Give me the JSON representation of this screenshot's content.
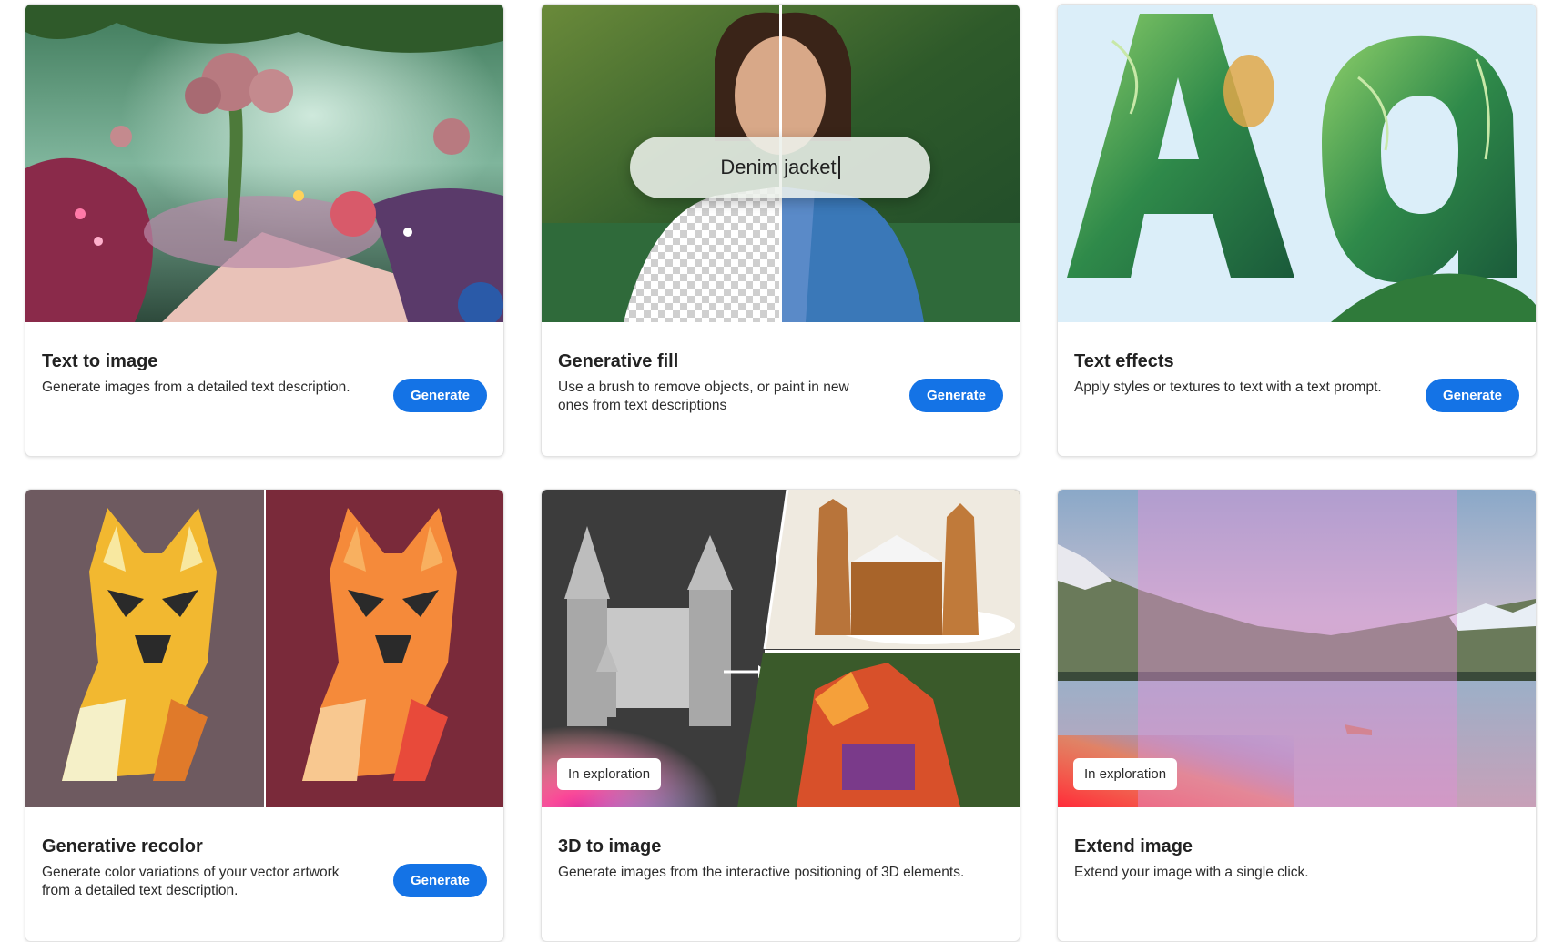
{
  "cards": [
    {
      "title": "Text to image",
      "description": "Generate images from a detailed text description.",
      "button": "Generate"
    },
    {
      "title": "Generative fill",
      "description": "Use a brush to remove objects, or paint in new ones from text descriptions",
      "button": "Generate",
      "prompt_text": "Denim jacket"
    },
    {
      "title": "Text effects",
      "description": "Apply styles or textures to text with a text prompt.",
      "button": "Generate"
    },
    {
      "title": "Generative recolor",
      "description": "Generate color variations of your vector artwork from a detailed text description.",
      "button": "Generate"
    },
    {
      "title": "3D to image",
      "description": "Generate images from the interactive positioning of 3D elements.",
      "badge": "In exploration"
    },
    {
      "title": "Extend image",
      "description": "Extend your image with a single click.",
      "badge": "In exploration"
    }
  ],
  "colors": {
    "accent": "#1473e6"
  }
}
